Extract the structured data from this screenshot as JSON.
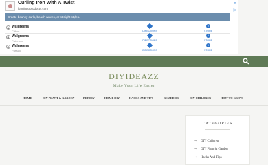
{
  "ad": {
    "title": "Curling Iron With A Twist",
    "url": "flamingoproducts.com",
    "description": "Create bouncy curls, beach waves, or straight styles.",
    "close_glyph": "✕",
    "info_glyph": "▷",
    "rows": [
      {
        "store": "Walgreens",
        "location": "Clifton",
        "directions": "DIRECTIONS",
        "store_info": "STORE"
      },
      {
        "store": "Walgreens",
        "location": "Paterson",
        "directions": "DIRECTIONS",
        "store_info": "STORE"
      },
      {
        "store": "Walgreens",
        "location": "Passaic",
        "directions": "DIRECTIONS",
        "store_info": "STORE"
      }
    ]
  },
  "colors": {
    "topbar": "#5f7a56",
    "accent_blue": "#2e74c9",
    "title_green": "#7a8c5c"
  },
  "site": {
    "title": "DIYIDEAZZ",
    "tagline": "Make Your Life Easier"
  },
  "nav": {
    "items": [
      {
        "label": "HOME"
      },
      {
        "label": "DIY PLANT & GARDEN"
      },
      {
        "label": "PET DIY"
      },
      {
        "label": "HOME DIY"
      },
      {
        "label": "HACKS AND TIPS"
      },
      {
        "label": "REMEDIES"
      },
      {
        "label": "DIY CHILDREN"
      },
      {
        "label": "HOW TO GROW"
      }
    ]
  },
  "sidebar": {
    "categories_title": "CATEGORIES",
    "categories": [
      {
        "label": "DIY Children"
      },
      {
        "label": "DIY Plant & Garden"
      },
      {
        "label": "Hacks And Tips"
      }
    ]
  }
}
